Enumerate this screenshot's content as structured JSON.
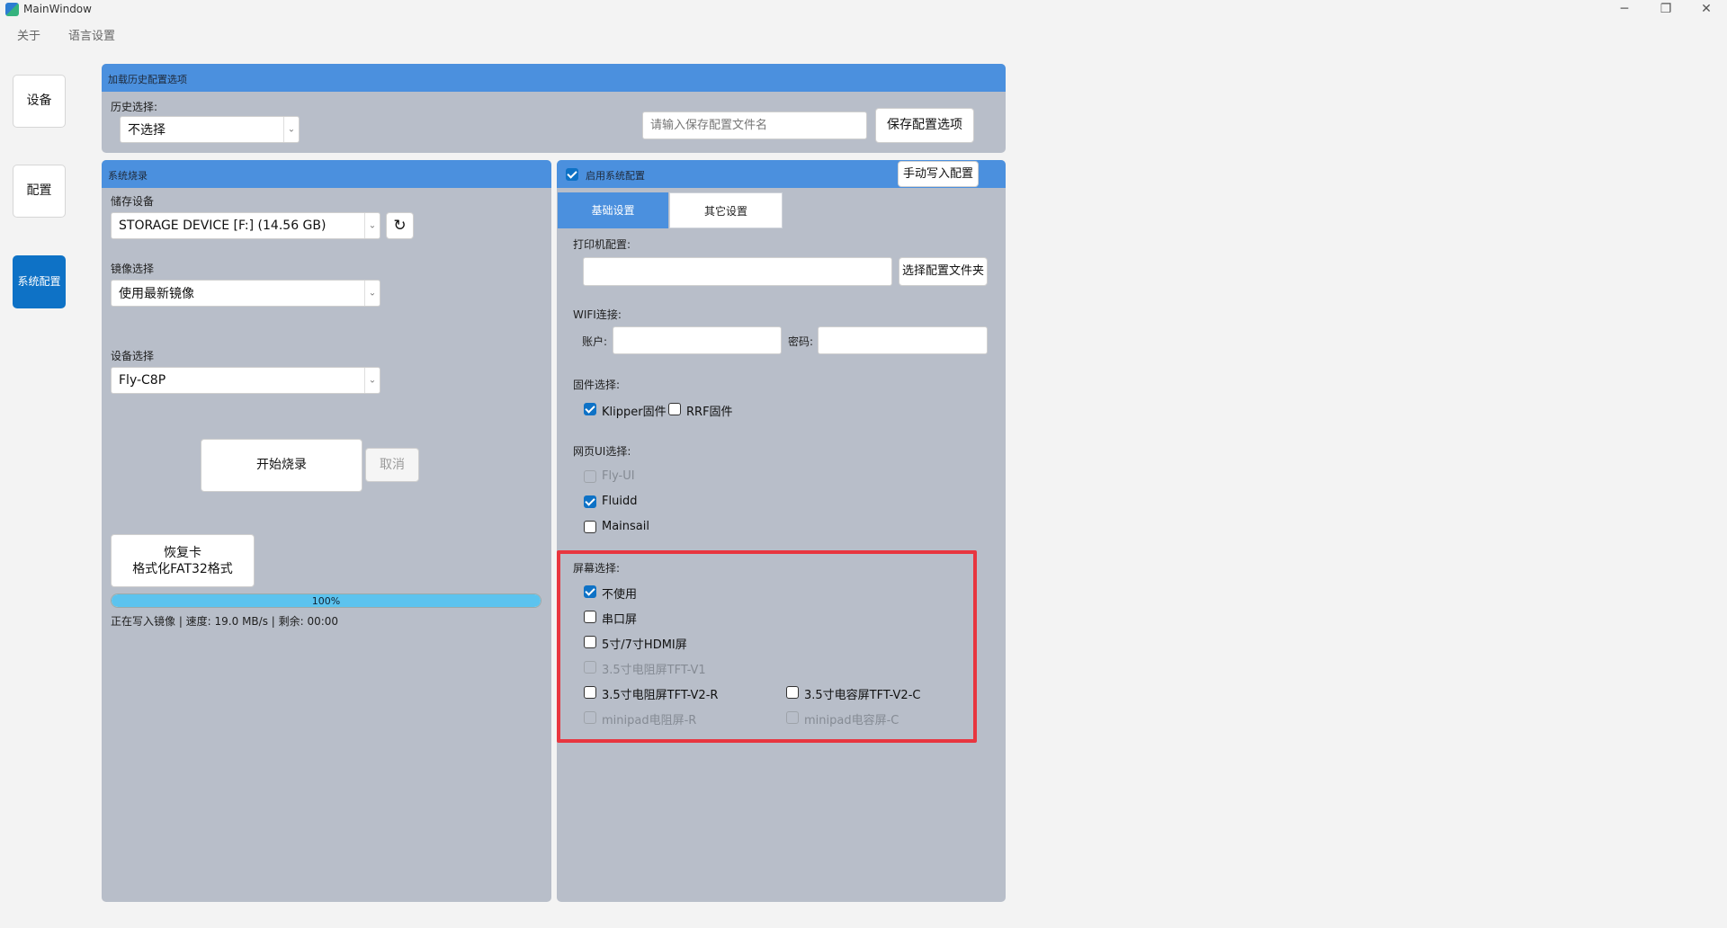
{
  "window": {
    "title": "MainWindow",
    "minimize_glyph": "─",
    "restore_glyph": "❐",
    "close_glyph": "✕"
  },
  "menu": {
    "items": [
      "关于",
      "语言设置"
    ]
  },
  "nav": {
    "items": [
      "设备",
      "配置",
      "系统配置"
    ],
    "active": "系统配置"
  },
  "history": {
    "header": "加载历史配置选项",
    "label": "历史选择:",
    "selected": "不选择",
    "filename_placeholder": "请输入保存配置文件名",
    "save_button": "保存配置选项"
  },
  "flash": {
    "header": "系统烧录",
    "storage_label": "储存设备",
    "storage_value": "STORAGE DEVICE [F:] (14.56 GB)",
    "image_label": "镜像选择",
    "image_value": "使用最新镜像",
    "device_label": "设备选择",
    "device_value": "Fly-C8P",
    "start_button": "开始烧录",
    "cancel_button": "取消",
    "restore_button_line1": "恢复卡",
    "restore_button_line2": "格式化FAT32格式",
    "progress": 100,
    "progress_text": "100%",
    "status": "正在写入镜像 | 速度: 19.0 MB/s | 剩余: 00:00"
  },
  "sysconfig": {
    "enable_label": "启用系统配置",
    "enable_checked": true,
    "write_button": "手动写入配置",
    "tabs": [
      "基础设置",
      "其它设置"
    ],
    "active_tab": "基础设置",
    "printer_label": "打印机配置:",
    "printer_value": "",
    "select_folder_button": "选择配置文件夹",
    "wifi_label": "WIFI连接:",
    "account_label": "账户:",
    "password_label": "密码:",
    "firmware_label": "固件选择:",
    "firmware": [
      {
        "label": "Klipper固件",
        "checked": true
      },
      {
        "label": "RRF固件",
        "checked": false
      }
    ],
    "webui_label": "网页UI选择:",
    "webui": [
      {
        "label": "Fly-UI",
        "checked": false,
        "disabled": true
      },
      {
        "label": "Fluidd",
        "checked": true,
        "disabled": false
      },
      {
        "label": "Mainsail",
        "checked": false,
        "disabled": false
      }
    ],
    "screen_label": "屏幕选择:",
    "screen": [
      {
        "label": "不使用",
        "checked": true,
        "disabled": false
      },
      {
        "label": "串口屏",
        "checked": false,
        "disabled": false
      },
      {
        "label": "5寸/7寸HDMI屏",
        "checked": false,
        "disabled": false
      },
      {
        "label": "3.5寸电阻屏TFT-V1",
        "checked": false,
        "disabled": true
      },
      {
        "label": "3.5寸电阻屏TFT-V2-R",
        "checked": false,
        "disabled": false
      },
      {
        "label": "3.5寸电容屏TFT-V2-C",
        "checked": false,
        "disabled": false
      },
      {
        "label": "minipad电阻屏-R",
        "checked": false,
        "disabled": true
      },
      {
        "label": "minipad电容屏-C",
        "checked": false,
        "disabled": true
      }
    ]
  },
  "colors": {
    "accent": "#0e72c6",
    "panel": "#b8bec9",
    "header": "#4b90de",
    "highlight": "#e8363f"
  }
}
